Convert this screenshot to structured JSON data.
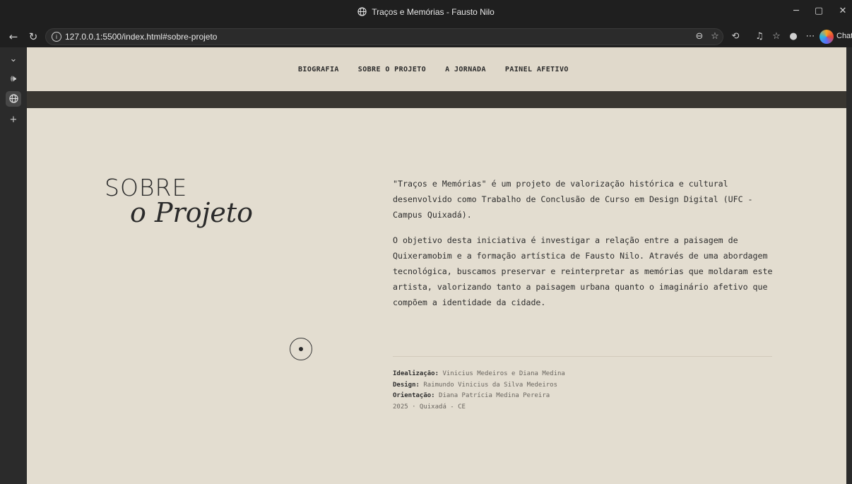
{
  "window": {
    "title": "Traços e Memórias - Fausto Nilo"
  },
  "browser": {
    "url": "127.0.0.1:5500/index.html#sobre-projeto",
    "chat_label": "Chat"
  },
  "nav": {
    "items": [
      "BIOGRAFIA",
      "SOBRE O PROJETO",
      "A JORNADA",
      "PAINEL AFETIVO"
    ]
  },
  "section": {
    "heading_line1": "SOBRE",
    "heading_line2": "o Projeto",
    "paragraph1": "\"Traços e Memórias\" é um projeto de valorização histórica e cultural desenvolvido como Trabalho de Conclusão de Curso em Design Digital (UFC - Campus Quixadá).",
    "paragraph2": "O objetivo desta iniciativa é investigar a relação entre a paisagem de Quixeramobim e a formação artística de Fausto Nilo. Através de uma abordagem tecnológica, buscamos preservar e reinterpretar as memórias que moldaram este artista, valorizando tanto a paisagem urbana quanto o imaginário afetivo que compõem a identidade da cidade."
  },
  "credits": {
    "idealizacao_label": "Idealização:",
    "idealizacao_value": "Vinicius Medeiros e Diana Medina",
    "design_label": "Design:",
    "design_value": "Raimundo Vinicius da Silva Medeiros",
    "orientacao_label": "Orientação:",
    "orientacao_value": "Diana Patrícia Medina Pereira",
    "footer": "2025 · Quixadá - CE"
  }
}
